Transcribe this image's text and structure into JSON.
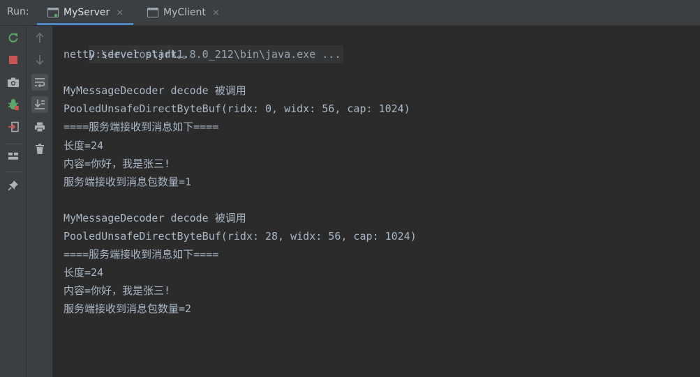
{
  "tabbar": {
    "run_label": "Run:",
    "tabs": [
      {
        "label": "MyServer",
        "active": true,
        "icon": "console-app-icon"
      },
      {
        "label": "MyClient",
        "active": false,
        "icon": "console-app-icon"
      }
    ],
    "close_glyph": "×"
  },
  "toolbar_left": {
    "buttons": [
      {
        "name": "rerun-icon",
        "color": "#59a869"
      },
      {
        "name": "stop-icon",
        "color": "#c75450"
      },
      {
        "name": "camera-icon",
        "color": "#afb1b3"
      },
      {
        "name": "debug-bug-icon",
        "color": "#59a869"
      },
      {
        "name": "exit-icon",
        "color": "#afb1b3"
      },
      {
        "name": "layout-icon",
        "color": "#afb1b3"
      },
      {
        "name": "pin-icon",
        "color": "#afb1b3"
      }
    ]
  },
  "toolbar_mid": {
    "buttons": [
      {
        "name": "arrow-up-icon"
      },
      {
        "name": "arrow-down-icon"
      },
      {
        "name": "soft-wrap-icon"
      },
      {
        "name": "scroll-to-end-icon"
      },
      {
        "name": "print-icon"
      },
      {
        "name": "trash-icon"
      }
    ]
  },
  "console": {
    "lines": [
      "D:\\develop\\jdk1.8.0_212\\bin\\java.exe ...",
      "netty server start。。",
      "",
      "MyMessageDecoder decode 被调用",
      "PooledUnsafeDirectByteBuf(ridx: 0, widx: 56, cap: 1024)",
      "====服务端接收到消息如下====",
      "长度=24",
      "内容=你好，我是张三!",
      "服务端接收到消息包数量=1",
      "",
      "MyMessageDecoder decode 被调用",
      "PooledUnsafeDirectByteBuf(ridx: 28, widx: 56, cap: 1024)",
      "====服务端接收到消息如下====",
      "长度=24",
      "内容=你好，我是张三!",
      "服务端接收到消息包数量=2"
    ]
  },
  "colors": {
    "background": "#2b2b2b",
    "panel": "#3c3f41",
    "accent": "#4a88c7",
    "text": "#a9b7c6"
  }
}
